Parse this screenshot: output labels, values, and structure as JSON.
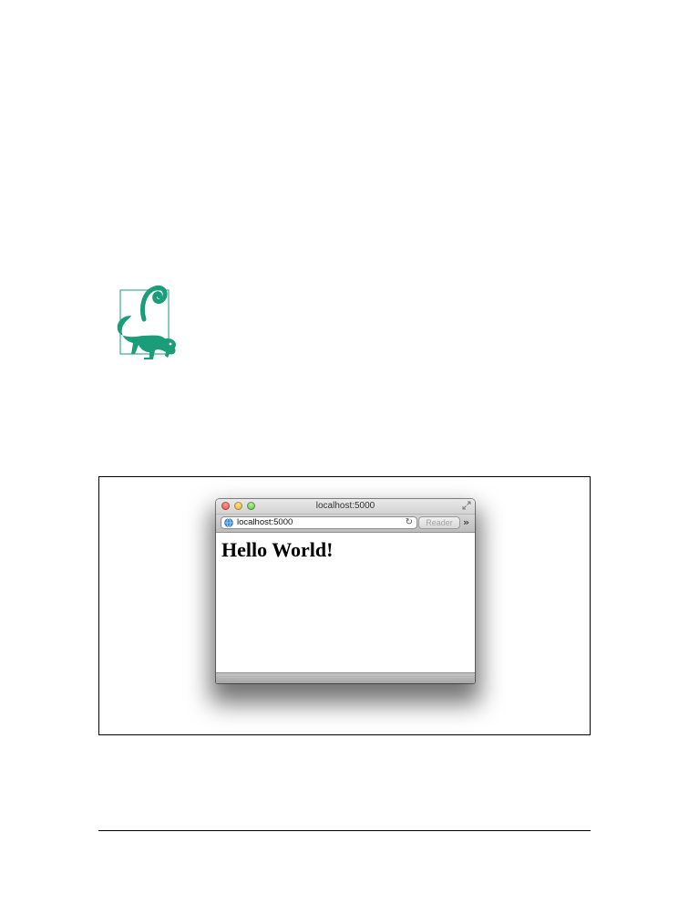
{
  "note_icon": {
    "icon": "lemur-icon",
    "color": "#1a9d78"
  },
  "figure": {
    "browser": {
      "window_title": "localhost:5000",
      "address": "localhost:5000",
      "reader_label": "Reader",
      "page_heading": "Hello World!",
      "icons": {
        "close": "close-button-icon",
        "minimize": "minimize-button-icon",
        "zoom": "zoom-button-icon",
        "fullscreen": "fullscreen-icon",
        "site": "globe-icon",
        "reload": "reload-icon",
        "overflow": "chevron-double-right-icon"
      }
    }
  }
}
